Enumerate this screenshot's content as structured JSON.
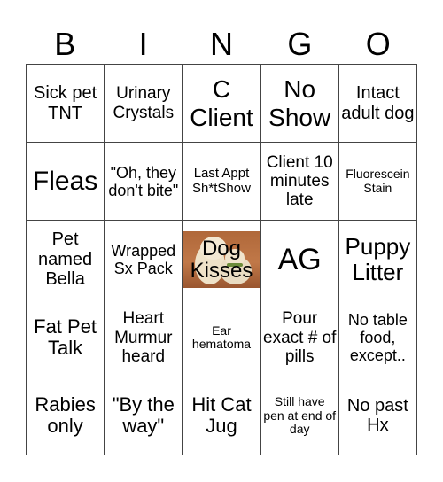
{
  "header": {
    "letters": [
      "B",
      "I",
      "N",
      "G",
      "O"
    ]
  },
  "board": {
    "rows": [
      [
        "Sick pet TNT",
        "Urinary Crystals",
        "C Client",
        "No Show",
        "Intact adult dog"
      ],
      [
        "Fleas",
        "\"Oh, they don't bite\"",
        "Last Appt Sh*tShow",
        "Client 10 minutes late",
        "Fluorescein Stain"
      ],
      [
        "Pet named Bella",
        "Wrapped Sx Pack",
        "Dog Kisses",
        "AG",
        "Puppy Litter"
      ],
      [
        "Fat Pet Talk",
        "Heart Murmur heard",
        "Ear hematoma",
        "Pour exact # of pills",
        "No table food, except.."
      ],
      [
        "Rabies only",
        "\"By the way\"",
        "Hit Cat Jug",
        "Still have pen at end of day",
        "No past Hx"
      ]
    ],
    "free_space": {
      "label": "Dog Kisses",
      "image": "puppies-photo"
    }
  }
}
